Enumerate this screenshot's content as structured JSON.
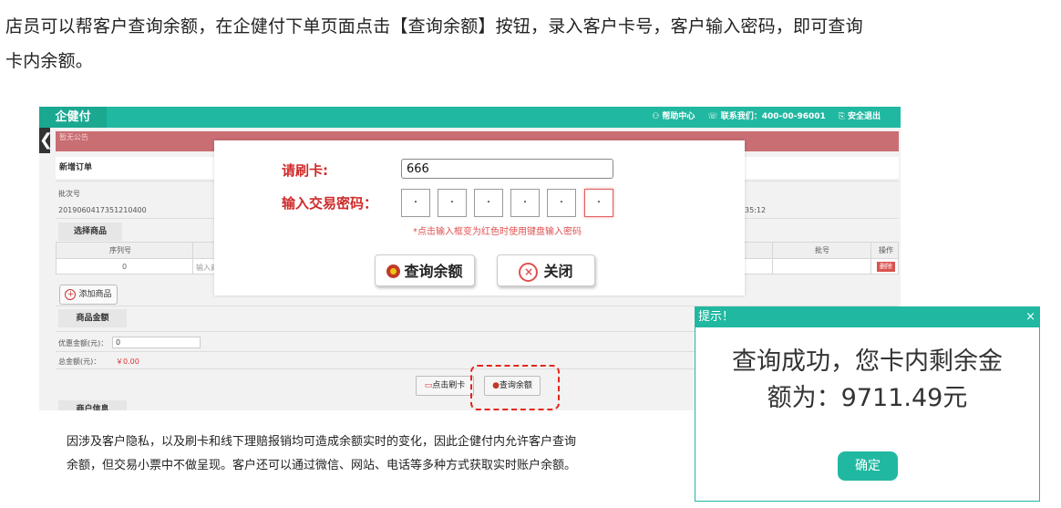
{
  "intro": {
    "line1": "店员可以帮客户查询余额，在企健付下单页面点击【查询余额】按钮，录入客户卡号，客户输入密码，即可查询",
    "line2": "卡内余额。"
  },
  "app": {
    "brand": "企健付",
    "help": "帮助中心",
    "contact": "联系我们：400-00-96001",
    "logout": "安全退出",
    "notice": "暂无公告",
    "side_arrow": "❮"
  },
  "order": {
    "section_title": "新增订单",
    "batch_label": "批次号",
    "batch_value": "2019060417351210400",
    "time_fragment": "35:12",
    "select_goods": "选择商品",
    "columns": [
      "序列号",
      "批号",
      "操作"
    ],
    "row_index": "0",
    "row_input_placeholder": "输入商",
    "delete": "删除",
    "add_goods": "添加商品",
    "goods_amount": "商品金额",
    "discount_label": "优惠金额(元)：",
    "discount_value": "0",
    "total_label": "总金额(元)：",
    "total_value": "￥0.00",
    "swipe_button": "点击刷卡",
    "query_button": "查询余额",
    "merchant_info": "商户信息"
  },
  "modal": {
    "card_label": "请刷卡:",
    "card_value": "666",
    "pin_label": "输入交易密码：",
    "pin_dots": [
      "·",
      "·",
      "·",
      "·",
      "·",
      "·"
    ],
    "hint": "*点击输入框变为红色时使用键盘输入密码",
    "query_button": "查询余额",
    "close_button": "关闭"
  },
  "bottom_note": {
    "line1": "因涉及客户隐私，以及刷卡和线下理赔报销均可造成余额实时的变化，因此企健付内允许客户查询",
    "line2": "余额，但交易小票中不做呈现。客户还可以通过微信、网站、电话等多种方式获取实时账户余额。"
  },
  "dialog": {
    "title": "提示！",
    "close": "×",
    "message_line1": "查询成功，您卡内剩余金",
    "message_line2": "额为：9711.49元",
    "ok": "确定"
  },
  "colors": {
    "brand": "#21b8a1",
    "alert_red": "#e3261b",
    "notice_bg": "#c96e73"
  }
}
